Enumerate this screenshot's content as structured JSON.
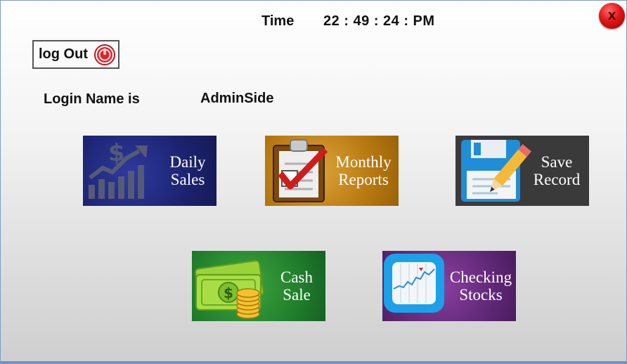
{
  "header": {
    "time_label": "Time",
    "time_value": "22 : 49 : 24 : PM",
    "close_label": "X"
  },
  "logout": {
    "label": "log Out"
  },
  "login": {
    "label": "Login Name is",
    "name": "AdminSide"
  },
  "tiles": [
    {
      "line1": "Daily",
      "line2": "Sales",
      "icon": "sales-chart-icon",
      "color": "#1c2370"
    },
    {
      "line1": "Monthly",
      "line2": "Reports",
      "icon": "clipboard-check-icon",
      "color": "#b87a10"
    },
    {
      "line1": "Save",
      "line2": "Record",
      "icon": "floppy-disk-pencil-icon",
      "color": "#3a3a3a"
    },
    {
      "line1": "Cash",
      "line2": "Sale",
      "icon": "money-coins-icon",
      "color": "#1f7d2b"
    },
    {
      "line1": "Checking",
      "line2": "Stocks",
      "icon": "stock-chart-icon",
      "color": "#5e2775"
    }
  ]
}
